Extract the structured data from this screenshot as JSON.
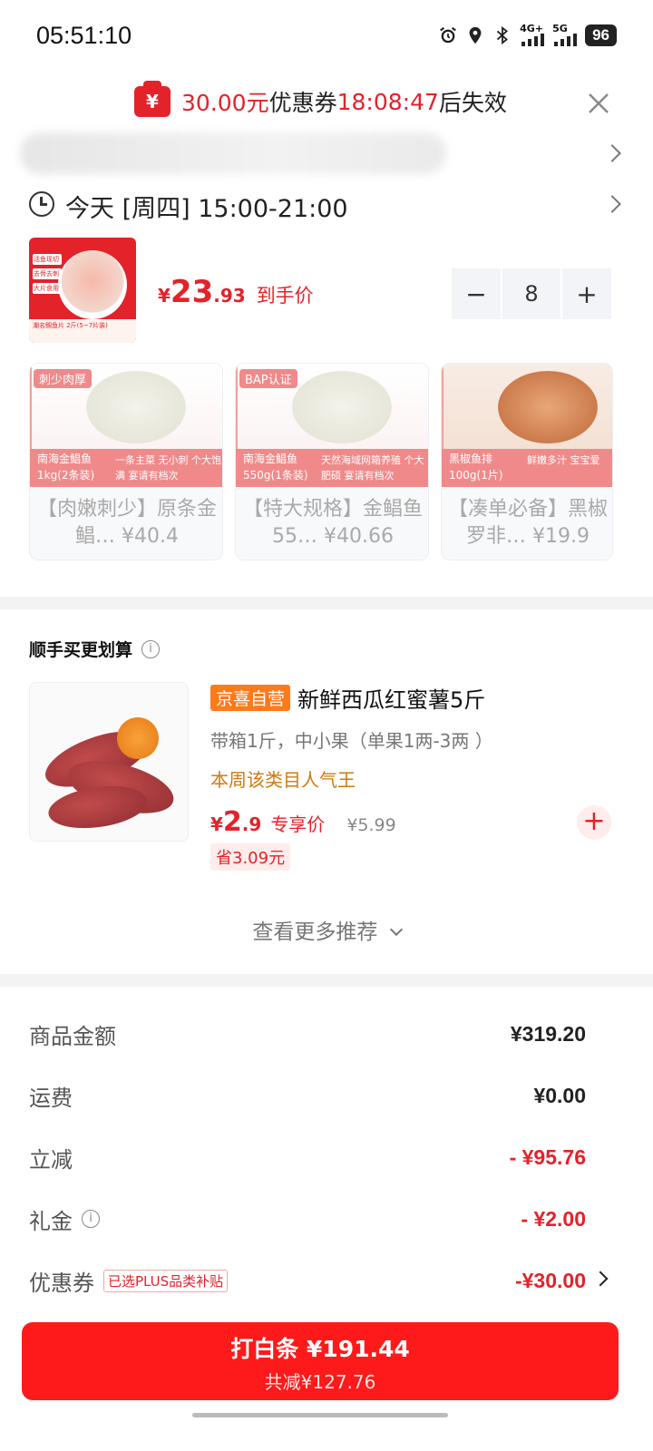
{
  "status": {
    "time": "05:51:10",
    "net1": "4G+",
    "net2": "5G",
    "battery": "96"
  },
  "coupon_banner": {
    "icon": "¥",
    "amount": "30.00元",
    "text1": "优惠券",
    "countdown": "18:08:47",
    "text2": "后失效"
  },
  "delivery": {
    "text": "今天 [周四] 15:00-21:00"
  },
  "product": {
    "image_tags": [
      "活鱼现切",
      "去骨去刺",
      "大片食用"
    ],
    "image_caption": "潮名鲷鱼片 2斤(5~7片装)",
    "price_symbol": "¥",
    "price_int": "23",
    "price_dec": ".93",
    "price_label": "到手价",
    "minus": "−",
    "quantity": "8",
    "plus": "+"
  },
  "carousel": [
    {
      "tag": "刺少肉厚",
      "band1": "南海金鲳鱼 1kg(2条装)",
      "band2": "一条主菜 无小刺 个大饱满 宴请有档次",
      "title": "【肉嫩刺少】原条金鲳… ¥40.4"
    },
    {
      "tag": "BAP认证",
      "band1": "南海金鲳鱼 550g(1条装)",
      "band2": "天然海域网箱养殖 个大肥硕 宴请有档次",
      "title": "【特大规格】金鲳鱼55… ¥40.66"
    },
    {
      "tag": "",
      "band1": "黑椒鱼排 100g(1片)",
      "band2": "鲜嫩多汁 宝宝爱",
      "title": "【凑单必备】黑椒罗非… ¥19.9"
    }
  ],
  "bundle": {
    "title": "顺手买更划算",
    "item": {
      "badge": "京喜自营",
      "name": "新鲜西瓜红蜜薯5斤",
      "spec": "带箱1斤，中小果（单果1两-3两 ）",
      "hot": "本周该类目人气王",
      "price_symbol": "¥",
      "price_int": "2",
      "price_dec": ".9",
      "price_label": "专享价",
      "orig_price": "¥5.99",
      "save": "省3.09元",
      "add": "+"
    },
    "more": "查看更多推荐"
  },
  "summary": {
    "goods_label": "商品金额",
    "goods_value": "¥319.20",
    "ship_label": "运费",
    "ship_value": "¥0.00",
    "discount_label": "立减",
    "discount_value": "- ¥95.76",
    "gift_label": "礼金",
    "gift_value": "- ¥2.00",
    "coupon_label": "优惠券",
    "coupon_tag": "已选PLUS品类补贴",
    "coupon_value": "-¥30.00"
  },
  "pay": {
    "main": "打白条 ¥191.44",
    "sub": "共减¥127.76"
  },
  "colors": {
    "accent": "#e4222a",
    "pay_button": "#fe1a1a",
    "badge_orange": "#ff7a1a"
  }
}
